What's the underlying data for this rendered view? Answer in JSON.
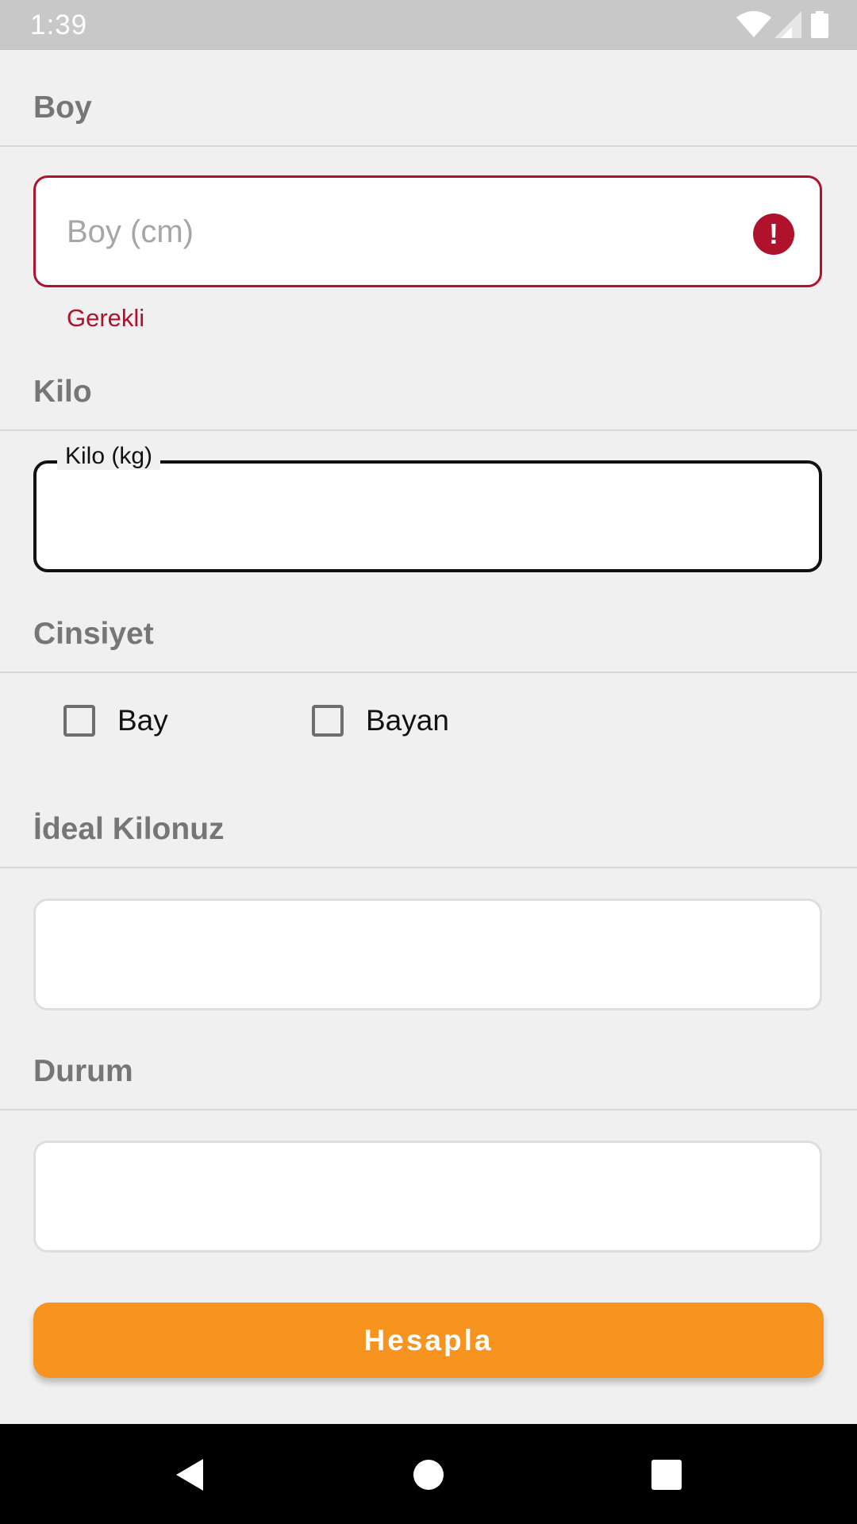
{
  "status_bar": {
    "time": "1:39",
    "icons": [
      "wifi-icon",
      "cellular-signal-icon",
      "battery-icon"
    ]
  },
  "form": {
    "height_section": {
      "label": "Boy",
      "placeholder": "Boy (cm)",
      "value": "",
      "error_text": "Gerekli",
      "error_icon": "error-icon"
    },
    "weight_section": {
      "label": "Kilo",
      "floating_label": "Kilo (kg)",
      "value": ""
    },
    "gender_section": {
      "label": "Cinsiyet",
      "options": [
        {
          "label": "Bay",
          "checked": false
        },
        {
          "label": "Bayan",
          "checked": false
        }
      ]
    },
    "ideal_weight_section": {
      "label": "İdeal Kilonuz",
      "value": ""
    },
    "status_section": {
      "label": "Durum",
      "value": ""
    },
    "submit_label": "Hesapla"
  },
  "colors": {
    "accent": "#f6941f",
    "error": "#b0122c",
    "background": "#f0f0f0",
    "section_label": "#767676"
  },
  "nav_bar": {
    "buttons": [
      "back-icon",
      "home-icon",
      "recents-icon"
    ]
  }
}
